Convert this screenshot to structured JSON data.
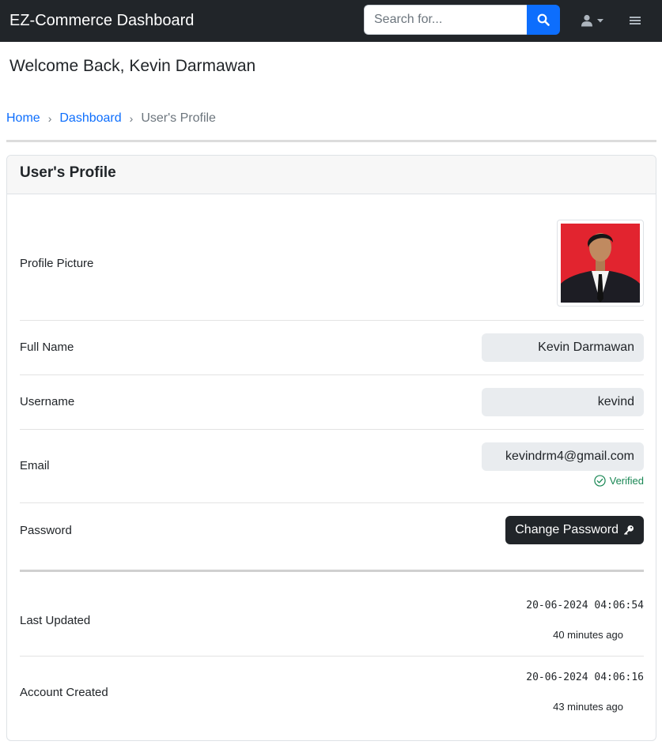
{
  "navbar": {
    "brand": "EZ-Commerce Dashboard",
    "search_placeholder": "Search for...",
    "search_icon": "search-icon",
    "user_icon": "user-icon",
    "menu_icon": "hamburger-icon"
  },
  "welcome": "Welcome Back, Kevin Darmawan",
  "breadcrumb": {
    "items": [
      "Home",
      "Dashboard"
    ],
    "active": "User's Profile"
  },
  "profile": {
    "title": "User's Profile",
    "picture_label": "Profile Picture",
    "full_name_label": "Full Name",
    "full_name": "Kevin Darmawan",
    "username_label": "Username",
    "username": "kevind",
    "email_label": "Email",
    "email": "kevindrm4@gmail.com",
    "verified": "Verified",
    "password_label": "Password",
    "change_password": "Change Password",
    "last_updated_label": "Last Updated",
    "last_updated": "20-06-2024 04:06:54",
    "last_updated_ago": "40 minutes ago",
    "created_label": "Account Created",
    "created": "20-06-2024 04:06:16",
    "created_ago": "43 minutes ago"
  },
  "colors": {
    "navbar_bg": "#212529",
    "primary": "#0d6efd",
    "success": "#198754",
    "photo_bg": "#e2242f"
  }
}
